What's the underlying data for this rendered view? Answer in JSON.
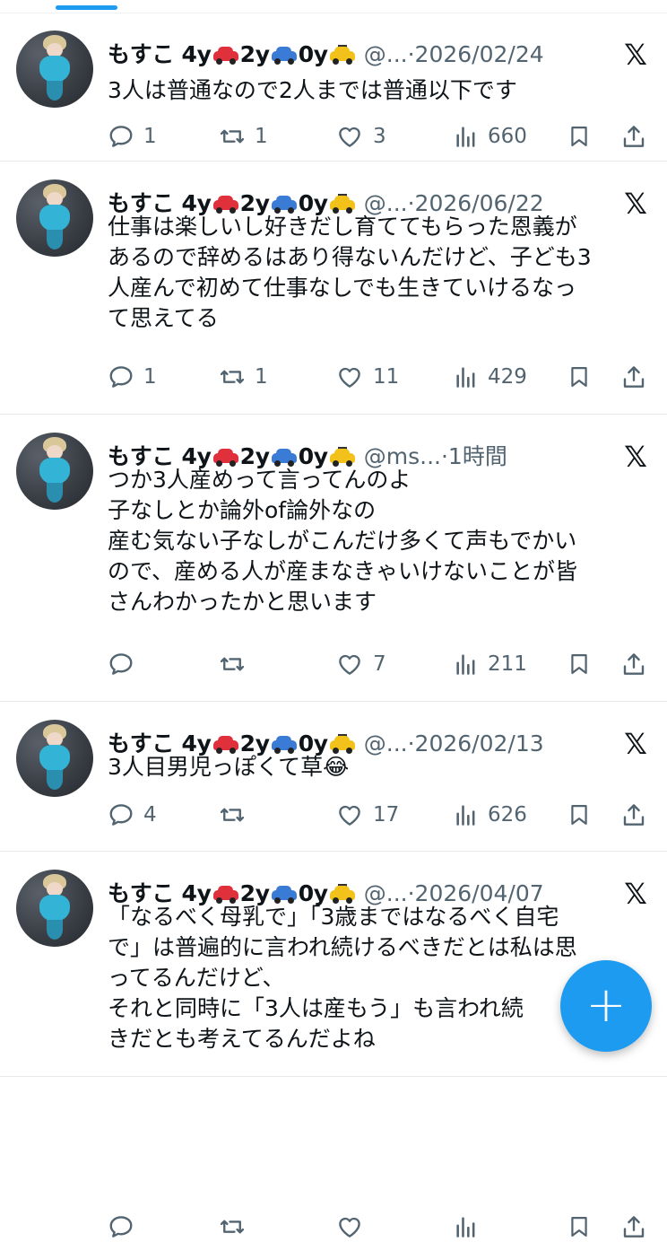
{
  "author": {
    "name": "もすこ 4y",
    "name_2y": "2y",
    "name_0y": "0y",
    "emoji": [
      "red-car",
      "blue-car",
      "taxi"
    ]
  },
  "tweets": [
    {
      "handle": "@...",
      "date": "2026/02/24",
      "text": "3人は普通なので2人までは普通以下です",
      "replies": "1",
      "retweets": "1",
      "likes": "3",
      "views": "660"
    },
    {
      "handle": "@...",
      "date": "2026/06/22",
      "text": "仕事は楽しいし好きだし育ててもらった恩義が\nあるので辞めるはあり得ないんだけど、子ども3\n人産んで初めて仕事なしでも生きていけるなっ\nて思えてる",
      "replies": "1",
      "retweets": "1",
      "likes": "11",
      "views": "429"
    },
    {
      "handle": "@ms...",
      "date": "1時間",
      "text": "つか3人産めって言ってんのよ\n子なしとか論外of論外なの\n産む気ない子なしがこんだけ多くて声もでかい\nので、産める人が産まなきゃいけないことが皆\nさんわかったかと思います",
      "replies": "",
      "retweets": "",
      "likes": "7",
      "views": "211"
    },
    {
      "handle": "@...",
      "date": "2026/02/13",
      "text": "3人目男児っぽくて草😂",
      "replies": "4",
      "retweets": "",
      "likes": "17",
      "views": "626"
    },
    {
      "handle": "@...",
      "date": "2026/04/07",
      "text": "「なるべく母乳で」「3歳まではなるべく自宅\nで」は普遍的に言われ続けるべきだとは私は思\nってるんだけど、\nそれと同時に「3人は産もう」も言われ続\nきだとも考えてるんだよね",
      "replies": "",
      "retweets": "",
      "likes": "",
      "views": ""
    }
  ],
  "dot": "·",
  "x_logo": "𝕏",
  "compose_symbol": "+",
  "colors": {
    "accent": "#1d9bf0",
    "muted": "#536471",
    "text": "#0f1419"
  }
}
